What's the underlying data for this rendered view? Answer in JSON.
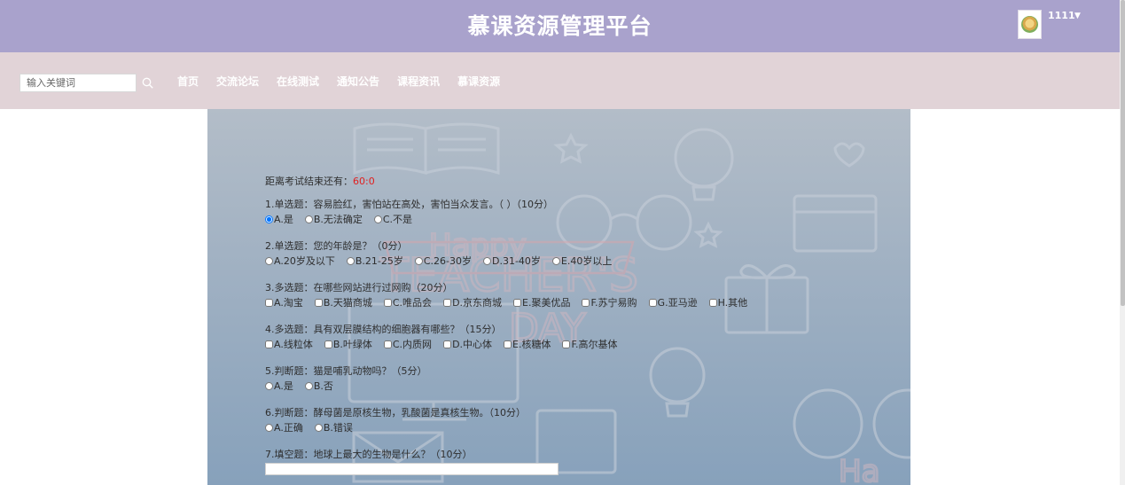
{
  "header": {
    "title": "慕课资源管理平台",
    "username": "1111",
    "caret": "▼"
  },
  "search": {
    "placeholder": "输入关键词"
  },
  "nav": {
    "items": [
      "首页",
      "交流论坛",
      "在线测试",
      "通知公告",
      "课程资讯",
      "慕课资源"
    ]
  },
  "exam": {
    "countdown_label": "距离考试结束还有：",
    "countdown_value": "60:0",
    "questions": [
      {
        "title": "1.单选题：容易脸红，害怕站在高处，害怕当众发言。（ ）（10分）",
        "input": "radio",
        "options": [
          {
            "label": "A.是",
            "checked": true
          },
          {
            "label": "B.无法确定",
            "checked": false
          },
          {
            "label": "C.不是",
            "checked": false
          }
        ]
      },
      {
        "title": "2.单选题：您的年龄是？（0分）",
        "input": "radio",
        "options": [
          {
            "label": "A.20岁及以下",
            "checked": false
          },
          {
            "label": "B.21-25岁",
            "checked": false
          },
          {
            "label": "C.26-30岁",
            "checked": false
          },
          {
            "label": "D.31-40岁",
            "checked": false
          },
          {
            "label": "E.40岁以上",
            "checked": false
          }
        ]
      },
      {
        "title": "3.多选题：在哪些网站进行过网购（20分）",
        "input": "checkbox",
        "options": [
          {
            "label": "A.淘宝",
            "checked": false
          },
          {
            "label": "B.天猫商城",
            "checked": false
          },
          {
            "label": "C.唯品会",
            "checked": false
          },
          {
            "label": "D.京东商城",
            "checked": false
          },
          {
            "label": "E.聚美优品",
            "checked": false
          },
          {
            "label": "F.苏宁易购",
            "checked": false
          },
          {
            "label": "G.亚马逊",
            "checked": false
          },
          {
            "label": "H.其他",
            "checked": false
          }
        ]
      },
      {
        "title": "4.多选题：具有双层膜结构的细胞器有哪些？（15分）",
        "input": "checkbox",
        "options": [
          {
            "label": "A.线粒体",
            "checked": false
          },
          {
            "label": "B.叶绿体",
            "checked": false
          },
          {
            "label": "C.内质网",
            "checked": false
          },
          {
            "label": "D.中心体",
            "checked": false
          },
          {
            "label": "E.核糖体",
            "checked": false
          },
          {
            "label": "F.高尔基体",
            "checked": false
          }
        ]
      },
      {
        "title": "5.判断题：猫是哺乳动物吗？（5分）",
        "input": "radio",
        "options": [
          {
            "label": "A.是",
            "checked": false
          },
          {
            "label": "B.否",
            "checked": false
          }
        ]
      },
      {
        "title": "6.判断题：酵母菌是原核生物，乳酸菌是真核生物。（10分）",
        "input": "radio",
        "options": [
          {
            "label": "A.正确",
            "checked": false
          },
          {
            "label": "B.错误",
            "checked": false
          }
        ]
      },
      {
        "title": "7.填空题：地球上最大的生物是什么？（10分）",
        "input": "text",
        "options": []
      }
    ]
  },
  "colors": {
    "header_bg": "#a9a2cc",
    "nav_bg": "#e1d3d7",
    "countdown": "#e02020"
  }
}
